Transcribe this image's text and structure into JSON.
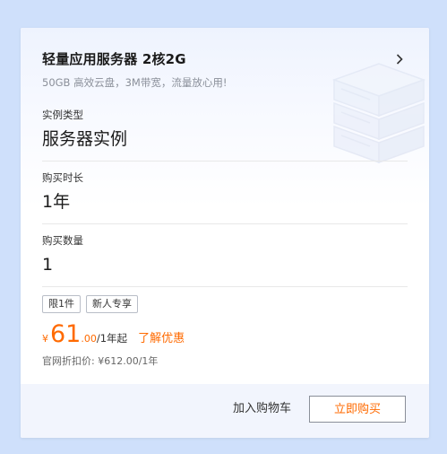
{
  "product": {
    "title": "轻量应用服务器 2核2G",
    "subtitle": "50GB 高效云盘，3M带宽，流量放心用!"
  },
  "fields": [
    {
      "label": "实例类型",
      "value": "服务器实例"
    },
    {
      "label": "购买时长",
      "value": "1年"
    },
    {
      "label": "购买数量",
      "value": "1"
    }
  ],
  "tags": [
    "限1件",
    "新人专享"
  ],
  "price": {
    "currency": "¥",
    "integer": "61",
    "decimal": ".00",
    "unit": "/1年起",
    "promo_link": "了解优惠",
    "original": "官网折扣价: ¥612.00/1年"
  },
  "footer": {
    "cart_label": "加入购物车",
    "buy_label": "立即购买"
  },
  "colors": {
    "page_bg": "#cfe0fb",
    "accent": "#ff6a00",
    "footer_bg": "#f2f5fd"
  },
  "icons": {
    "chevron": "chevron-right-icon",
    "illustration": "server-illustration"
  }
}
